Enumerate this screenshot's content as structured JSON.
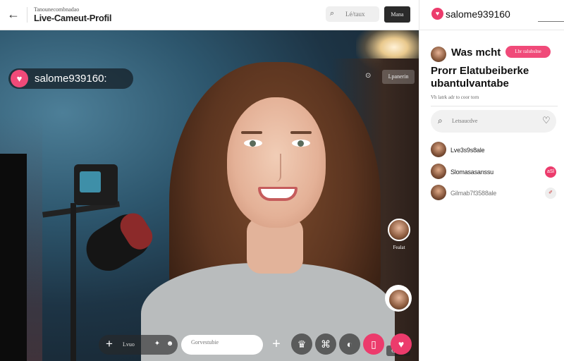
{
  "header": {
    "back_icon": "←",
    "breadcrumb": "Tanounecombnadao",
    "title": "Live-Cameut-Profil",
    "search_label": "Lé/taux",
    "action_label": "Mana"
  },
  "stream": {
    "live_heart_icon": "♥",
    "username": "salome939160:",
    "overlay_icon": "⊙",
    "overlay_label": "Lpanerin",
    "viewer_top_label": "Fealat",
    "chat_label": "Cwrct",
    "controls": {
      "plus_icon": "+",
      "group_label": "Lvuo",
      "icon_a": "✦",
      "icon_b": "☻",
      "input_placeholder": "Gorvestubie",
      "add_icon": "+",
      "crown_icon": "♛",
      "share_icon": "⌘",
      "record_icon": "◐",
      "phone_icon": "▯",
      "heart_icon": "♥"
    }
  },
  "panel": {
    "heart_icon": "♥",
    "username": "salome939160",
    "question": "Was mcht",
    "pill": "Lbr ralubslne",
    "headline": "Prorr  Elatubeiberke ubantulvantabe",
    "meta": "Vh latrk adr to coor torn",
    "search_icon": "⌕",
    "search_label": "Letsaucdve",
    "search_heart_icon": "♡",
    "viewers": [
      {
        "name": "Lve3s9s8ale",
        "badge": ""
      },
      {
        "name": "Slomasasanssu",
        "badge": "aSl"
      },
      {
        "name": "Gilmab7f3588ale",
        "badge": "✐"
      }
    ]
  },
  "colors": {
    "accent": "#ec3b6c",
    "dark": "#2b2b2b"
  }
}
